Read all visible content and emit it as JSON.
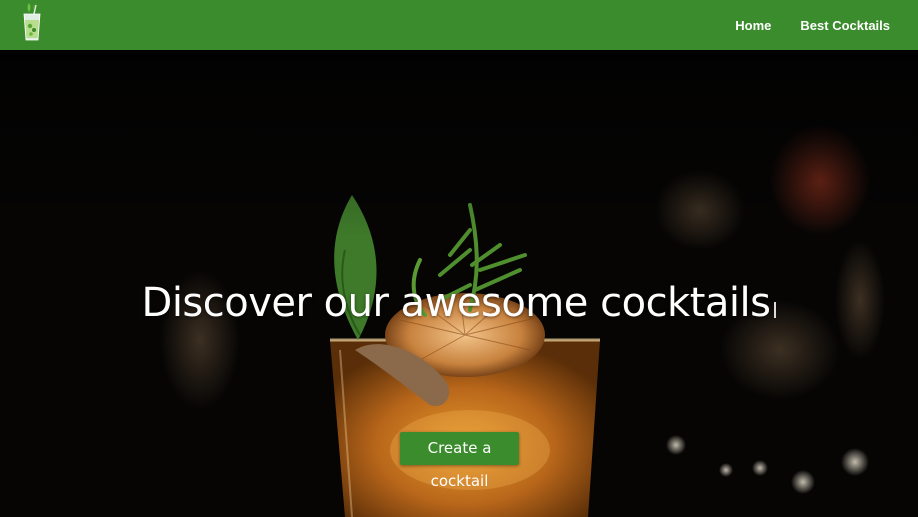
{
  "navbar": {
    "logo_icon": "cocktail-glass-icon",
    "links": [
      {
        "label": "Home"
      },
      {
        "label": "Best Cocktails"
      }
    ],
    "background_color": "#3b8c2c"
  },
  "hero": {
    "title": "Discover our awesome cocktails",
    "cta_label": "Create a cocktail",
    "background_image": "cocktail glass with garnish on dark bar background"
  },
  "colors": {
    "brand_green": "#3b8c2c",
    "text": "#ffffff"
  }
}
